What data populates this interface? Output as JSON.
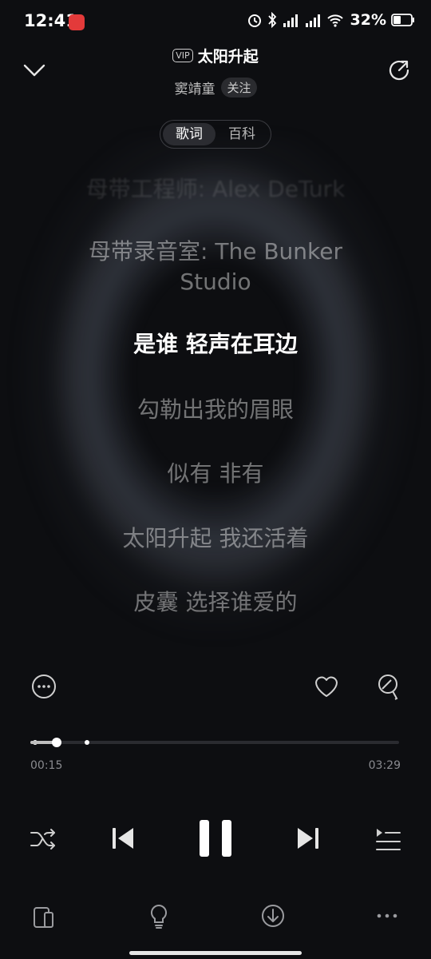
{
  "status": {
    "time": "12:41",
    "signal1": "5G",
    "signal2": "5G",
    "battery": "32%"
  },
  "song": {
    "vip_badge": "VIP",
    "title": "太阳升起",
    "artist": "窦靖童",
    "follow": "关注"
  },
  "tabs": [
    {
      "label": "歌词",
      "active": true
    },
    {
      "label": "百科",
      "active": false
    }
  ],
  "lyrics": [
    "母带工程师: Alex DeTurk",
    "母带录音室: The Bunker",
    "Studio",
    "是谁 轻声在耳边",
    "勾勒出我的眉眼",
    "似有 非有",
    "太阳升起 我还活着",
    "皮囊 选择谁爱的"
  ],
  "current_lyric_index": 3,
  "playback": {
    "current": "00:15",
    "total": "03:29",
    "progress_fraction": 0.072
  },
  "icons": {
    "collapse": "chevron-down-icon",
    "share": "share-icon",
    "more": "more-circle-icon",
    "like": "heart-icon",
    "comment": "comment-icon",
    "shuffle": "shuffle-icon",
    "prev": "previous-icon",
    "pause": "pause-icon",
    "next": "next-icon",
    "playlist": "playlist-icon",
    "device": "device-icon",
    "tip": "lightbulb-icon",
    "download": "download-icon",
    "overflow": "overflow-icon"
  },
  "colors": {
    "background": "#0d0e11",
    "active_lyric": "#ffffff",
    "app_badge": "#e33a3a"
  }
}
